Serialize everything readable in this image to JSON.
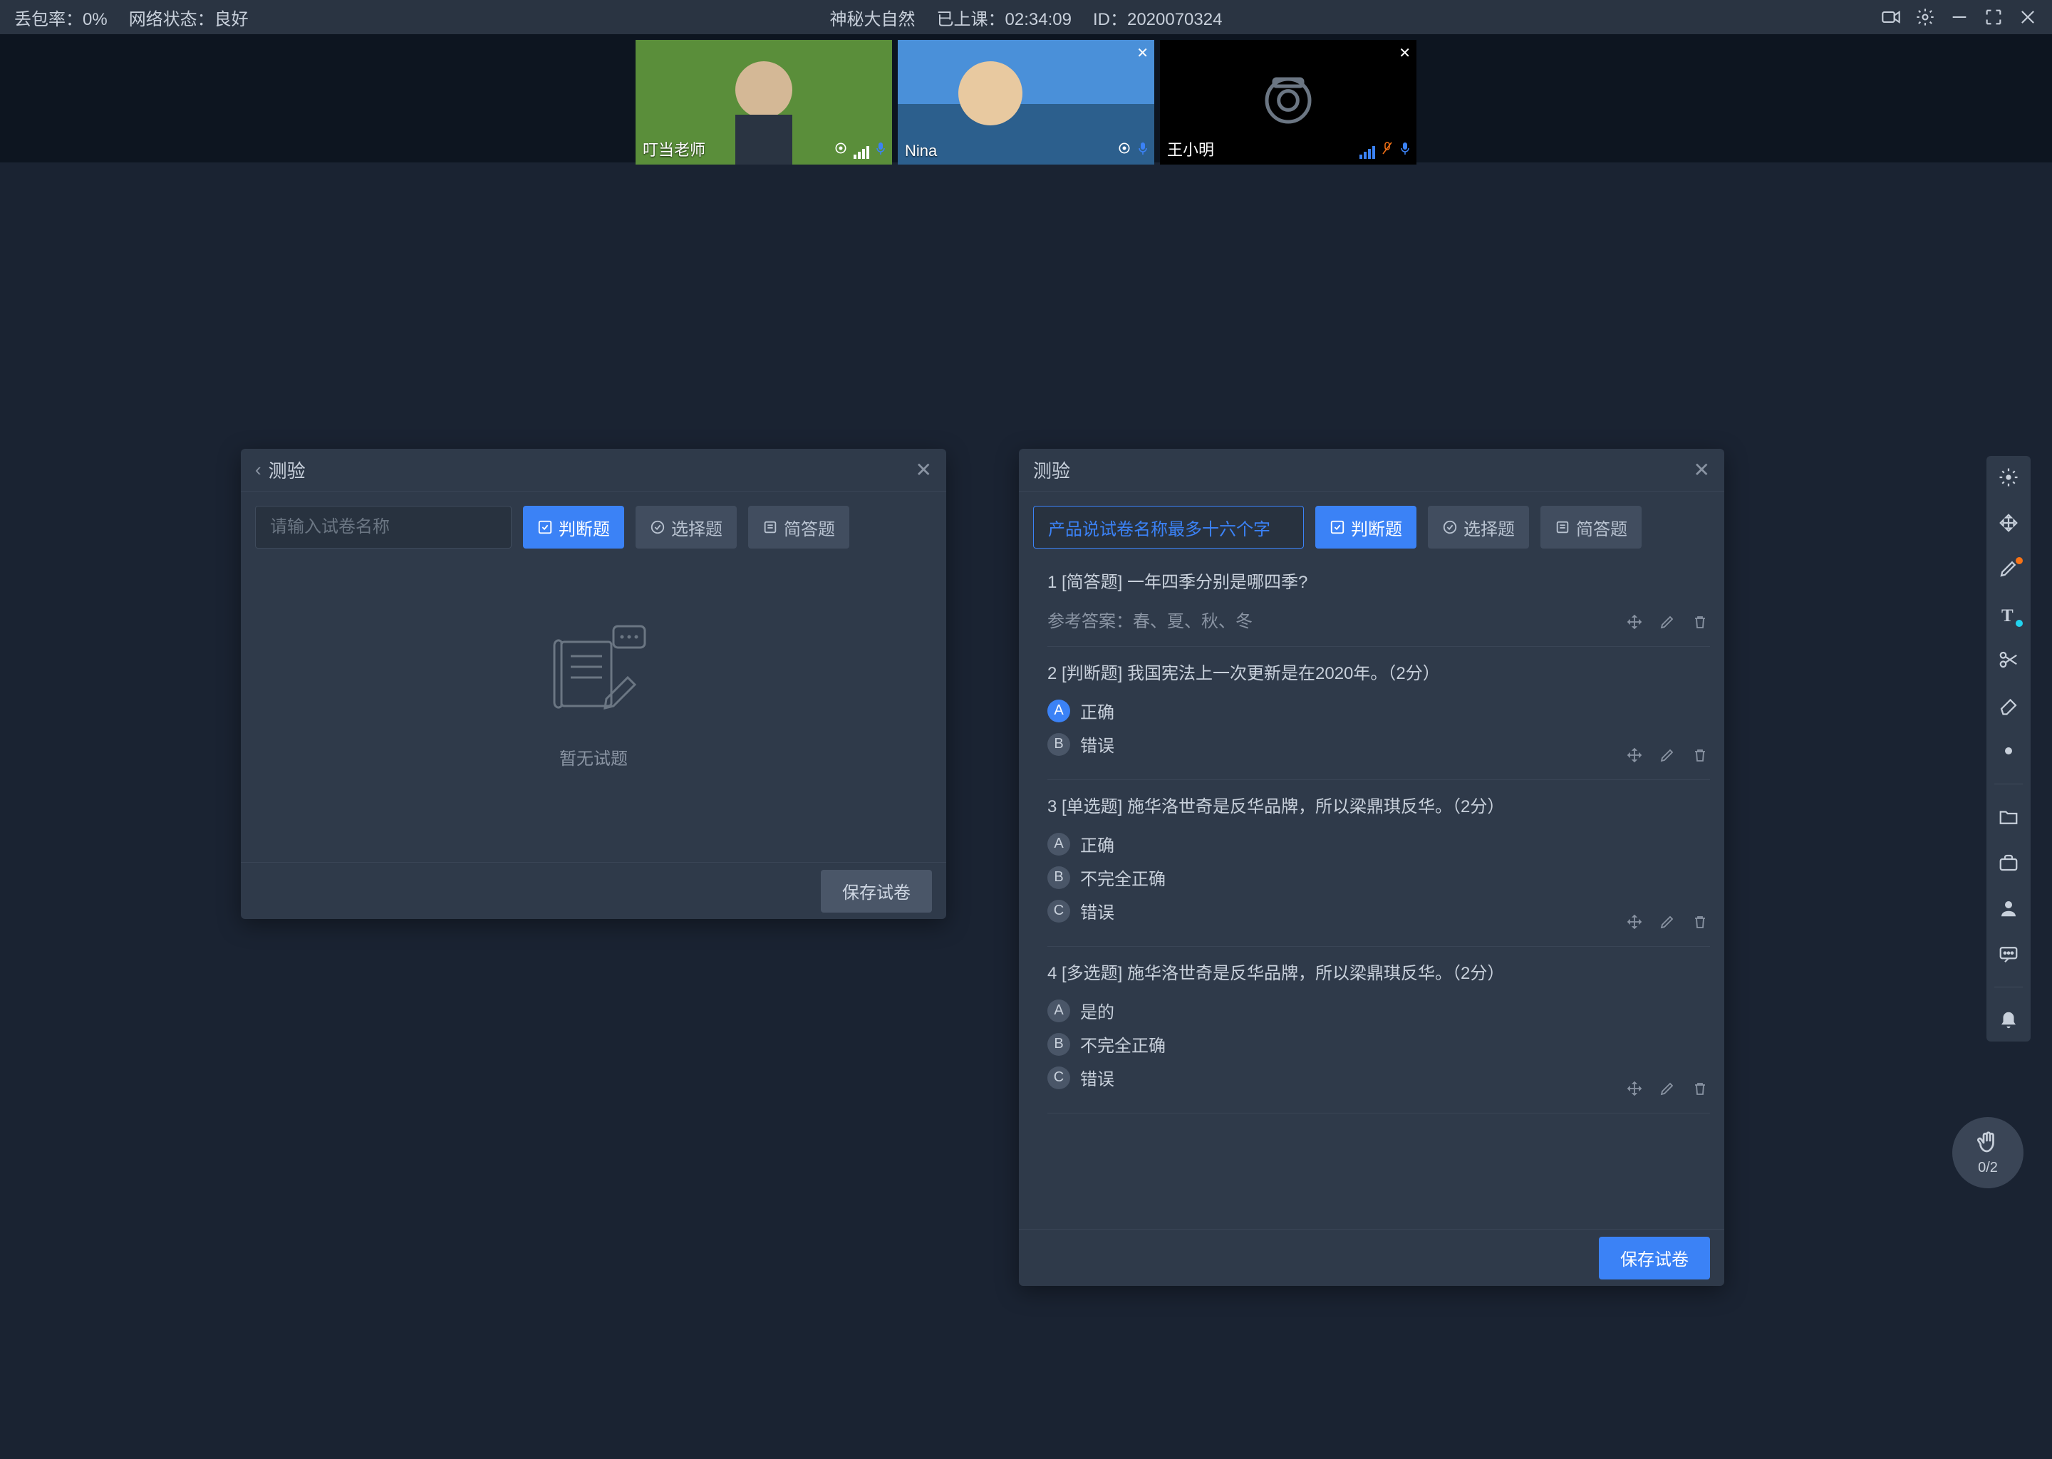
{
  "top": {
    "loss_label": "丢包率：0%",
    "net_label": "网络状态：良好",
    "class_title": "神秘大自然",
    "elapsed_label": "已上课：02:34:09",
    "session_id": "ID：2020070324"
  },
  "video_tiles": [
    {
      "name": "叮当老师",
      "cam_on": true
    },
    {
      "name": "Nina",
      "cam_on": true
    },
    {
      "name": "王小明",
      "cam_on": false
    }
  ],
  "panel_left": {
    "title": "测验",
    "input_placeholder": "请输入试卷名称",
    "btn_judgment": "判断题",
    "btn_choice": "选择题",
    "btn_short": "简答题",
    "empty_text": "暂无试题",
    "save_btn": "保存试卷"
  },
  "panel_right": {
    "title": "测验",
    "input_value": "产品说试卷名称最多十六个字",
    "btn_judgment": "判断题",
    "btn_choice": "选择题",
    "btn_short": "简答题",
    "save_btn": "保存试卷",
    "questions": [
      {
        "num": "1",
        "type_label": "[简答题]",
        "text": "一年四季分别是哪四季?",
        "ref_answer_label": "参考答案：春、夏、秋、冬"
      },
      {
        "num": "2",
        "type_label": "[判断题]",
        "text": "我国宪法上一次更新是在2020年。（2分）",
        "options": [
          {
            "letter": "A",
            "text": "正确",
            "selected": true
          },
          {
            "letter": "B",
            "text": "错误",
            "selected": false
          }
        ]
      },
      {
        "num": "3",
        "type_label": "[单选题]",
        "text": "施华洛世奇是反华品牌，所以梁鼎琪反华。（2分）",
        "options": [
          {
            "letter": "A",
            "text": "正确",
            "selected": false
          },
          {
            "letter": "B",
            "text": "不完全正确",
            "selected": false
          },
          {
            "letter": "C",
            "text": "错误",
            "selected": false
          }
        ]
      },
      {
        "num": "4",
        "type_label": "[多选题]",
        "text": "施华洛世奇是反华品牌，所以梁鼎琪反华。（2分）",
        "options": [
          {
            "letter": "A",
            "text": "是的",
            "selected": false
          },
          {
            "letter": "B",
            "text": "不完全正确",
            "selected": false
          },
          {
            "letter": "C",
            "text": "错误",
            "selected": false
          }
        ]
      }
    ]
  },
  "hand_count": "0/2"
}
